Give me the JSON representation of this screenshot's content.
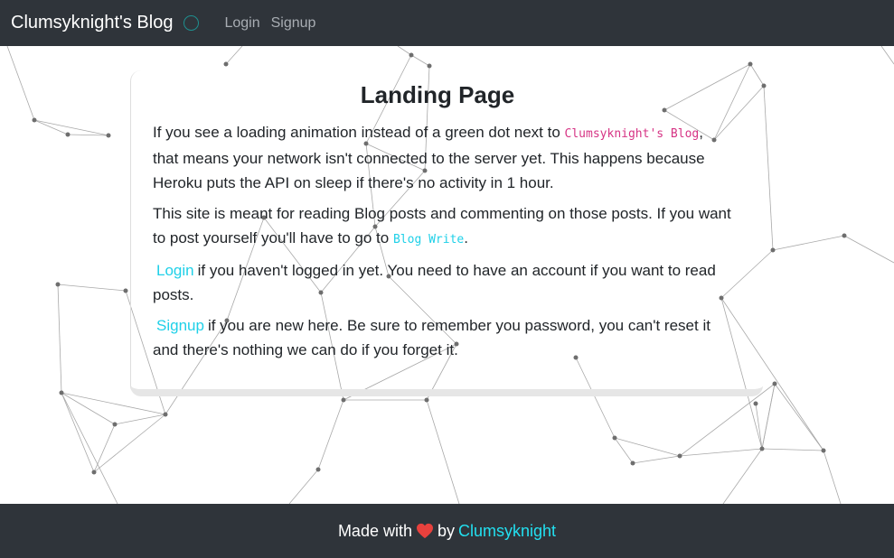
{
  "navbar": {
    "brand": "Clumsyknight's Blog",
    "links": [
      "Login",
      "Signup"
    ],
    "status_color": "#1e8f8f"
  },
  "card": {
    "title": "Landing Page",
    "p1_before": "If you see a loading animation instead of a green dot next to ",
    "p1_code": "Clumsyknight's Blog",
    "p1_after": ", that means your network isn't connected to the server yet. This happens because Heroku puts the API on sleep if there's no activity in 1 hour.",
    "p2_before": "This site is meant for reading Blog posts and commenting on those posts. If you want to post yourself you'll have to go to ",
    "p2_code": "Blog Write",
    "p2_after": ".",
    "p3_link": "Login",
    "p3_text": "if you haven't logged in yet. You need to have an account if you want to read posts.",
    "p4_link": "Signup",
    "p4_text": "if you are new here. Be sure to remember you password, you can't reset it and there's nothing we can do if you forget it."
  },
  "footer": {
    "made_with": "Made with",
    "by": "by",
    "author": "Clumsyknight",
    "heart_color": "#e8413d"
  },
  "colors": {
    "navbar_bg": "#2f343a",
    "accent_cyan": "#1fd0e8",
    "code_pink": "#d63384"
  },
  "icons": [
    "status-ring-icon",
    "heart-icon"
  ]
}
